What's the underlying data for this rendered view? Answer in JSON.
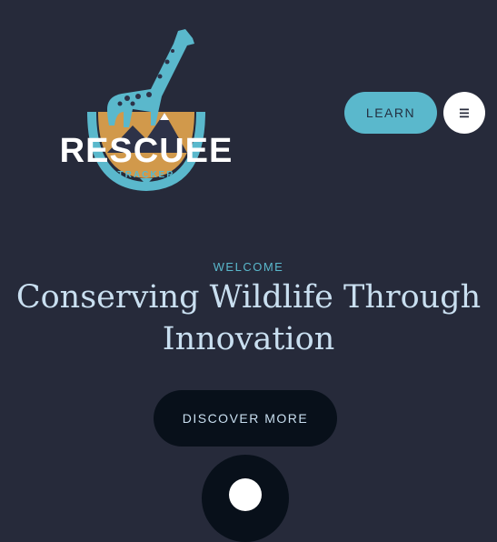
{
  "header": {
    "logo": {
      "wordmark": "RESCUEE",
      "subtext": "TRACKER"
    },
    "learn_label": "LEARN",
    "menu_icon": "hamburger-menu-icon"
  },
  "hero": {
    "eyebrow": "WELCOME",
    "title": "Conserving Wildlife Through Innovation",
    "cta_label": "DISCOVER MORE",
    "scroll_icon": "scroll-down-icon"
  },
  "colors": {
    "background": "#262a3a",
    "accent": "#5ab8cc",
    "headline": "#c9dff0",
    "dark_button": "#08101a",
    "logo_orange": "#d1994b"
  }
}
